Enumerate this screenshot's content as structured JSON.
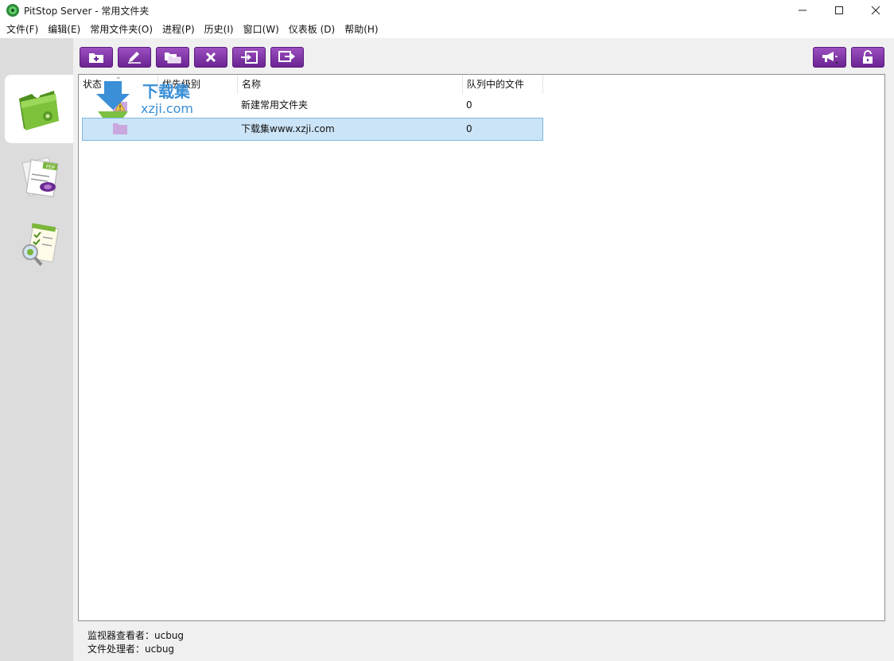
{
  "window": {
    "title": "PitStop Server  -  常用文件夹",
    "controls": {
      "minimize": "—",
      "maximize": "☐",
      "close": "✕"
    }
  },
  "menu": [
    "文件(F)",
    "编辑(E)",
    "常用文件夹(O)",
    "进程(P)",
    "历史(I)",
    "窗口(W)",
    "仪表板 (D)",
    "帮助(H)"
  ],
  "sidebar": {
    "items": [
      {
        "name": "hot-folders",
        "icon": "green-folder-icon",
        "active": true
      },
      {
        "name": "process-plans",
        "icon": "pdf-documents-icon",
        "active": false
      },
      {
        "name": "history",
        "icon": "checklist-magnifier-icon",
        "active": false
      }
    ]
  },
  "toolbar": {
    "buttons": [
      {
        "name": "new-folder",
        "icon": "folder-add-icon"
      },
      {
        "name": "edit",
        "icon": "pencil-icon"
      },
      {
        "name": "duplicate",
        "icon": "folders-icon"
      },
      {
        "name": "delete",
        "icon": "x-icon"
      },
      {
        "name": "import",
        "icon": "import-icon"
      },
      {
        "name": "export",
        "icon": "export-icon"
      }
    ],
    "right_buttons": [
      {
        "name": "announce",
        "icon": "megaphone-icon"
      },
      {
        "name": "unlock",
        "icon": "unlock-icon"
      }
    ],
    "accent": "#7b2fa3"
  },
  "table": {
    "columns": [
      "状态",
      "优先级别",
      "名称",
      "队列中的文件"
    ],
    "rows": [
      {
        "status": "warning-folder-icon",
        "priority": "",
        "name": "新建常用文件夹",
        "queue": "0",
        "selected": false
      },
      {
        "status": "folder-icon",
        "priority": "",
        "name": "下载集www.xzji.com",
        "queue": "0",
        "selected": true
      }
    ]
  },
  "watermark": {
    "line1": "下载集",
    "line2": "xzji.com",
    "color": "#3a8fd6"
  },
  "status": {
    "monitor_viewer": "监视器查看者：ucbug",
    "file_processor": "文件处理者：ucbug"
  }
}
